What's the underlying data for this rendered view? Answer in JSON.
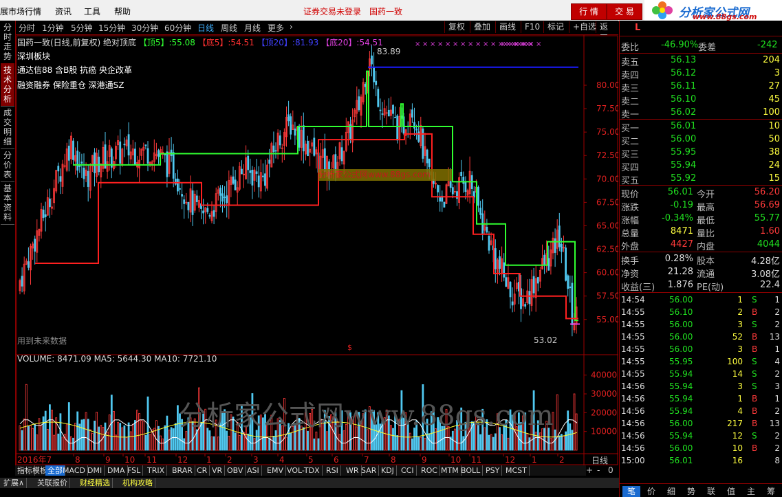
{
  "menu": {
    "title": "展市场行情",
    "items": [
      "资讯",
      "工具",
      "帮助"
    ],
    "notice1": "证券交易未登录",
    "notice2": "国药一致",
    "btn_quote": "行 情",
    "btn_trade": "交 易"
  },
  "logo": {
    "name": "分析家公式网",
    "url": "www.88gs.com"
  },
  "left_tabs": [
    "分时走势",
    "技术分析",
    "成交明细",
    "分价表",
    "基本资料"
  ],
  "periods": [
    "分时",
    "1分钟",
    "5分钟",
    "15分钟",
    "30分钟",
    "60分钟",
    "日线",
    "周线",
    "月线",
    "更多"
  ],
  "active_period": "日线",
  "toolbar": [
    "复权",
    "叠加",
    "画线",
    "F10",
    "标记",
    "+自选",
    "返回"
  ],
  "indicator_line": {
    "name": "国药一致(日线,前复权)",
    "formula": "绝对顶底",
    "top5_label": "【顶5】",
    "top5": "55.08",
    "bot5_label": "【底5】",
    "bot5": "54.51",
    "top20_label": "【顶20】",
    "top20": "81.93",
    "bot20_label": "【底20】",
    "bot20": "54.51"
  },
  "concepts": [
    "深圳板块",
    "通达信88 含B股 抗癌 央企改革",
    "融资融券 保险重仓 深港通SZ"
  ],
  "watermark_main": "分析家公式网www.88gs.com",
  "watermark_vol": "分析家公式网www.88gs.com",
  "future_data": "用到未来数据",
  "high_label": "83.89",
  "low_label": "53.02",
  "price_ticks": [
    "80.00",
    "77.50",
    "75.00",
    "72.50",
    "70.00",
    "67.50",
    "65.00",
    "62.50",
    "60.00",
    "57.50",
    "55.00"
  ],
  "volume_line": {
    "vol": "VOLUME: 8471.09",
    "ma5": "MA5: 5644.30",
    "ma10": "MA10: 7721.10"
  },
  "vol_ticks": [
    "40000",
    "30000",
    "20000",
    "10000"
  ],
  "dates": [
    "2016年7",
    "8",
    "9",
    "10",
    "11",
    "12",
    "1",
    "2",
    "3",
    "4",
    "5",
    "6",
    "7",
    "8",
    "9",
    "10",
    "11",
    "12",
    "1",
    "2"
  ],
  "period_label": "日线",
  "indicator_tabs": [
    "指标",
    "模板",
    "全部",
    "MACD",
    "DMI",
    "DMA",
    "FSL",
    "TRIX",
    "BRAR",
    "CR",
    "VR",
    "OBV",
    "ASI",
    "EMV",
    "VOL-TDX",
    "RSI",
    "WR",
    "SAR",
    "KDJ",
    "CCI",
    "ROC",
    "MTM",
    "BOLL",
    "PSY",
    "MCST"
  ],
  "ext_tabs": [
    "扩展∧",
    "关联报价",
    "财经精选",
    "机构攻略"
  ],
  "stock": {
    "code_mark": "L",
    "webi_label": "委比",
    "webi": "-46.90%",
    "wecha_label": "委差",
    "wecha": "-242",
    "asks": [
      {
        "l": "卖五",
        "p": "56.13",
        "v": "204"
      },
      {
        "l": "卖四",
        "p": "56.12",
        "v": "3"
      },
      {
        "l": "卖三",
        "p": "56.11",
        "v": "27"
      },
      {
        "l": "卖二",
        "p": "56.10",
        "v": "45"
      },
      {
        "l": "卖一",
        "p": "56.02",
        "v": "100"
      }
    ],
    "bids": [
      {
        "l": "买一",
        "p": "56.01",
        "v": "10"
      },
      {
        "l": "买二",
        "p": "56.00",
        "v": "50"
      },
      {
        "l": "买三",
        "p": "55.95",
        "v": "38"
      },
      {
        "l": "买四",
        "p": "55.94",
        "v": "24"
      },
      {
        "l": "买五",
        "p": "55.92",
        "v": "15"
      }
    ],
    "quote": [
      {
        "l1": "现价",
        "v1": "56.01",
        "l2": "今开",
        "v2": "56.20"
      },
      {
        "l1": "涨跌",
        "v1": "-0.19",
        "l2": "最高",
        "v2": "56.69"
      },
      {
        "l1": "涨幅",
        "v1": "-0.34%",
        "l2": "最低",
        "v2": "55.77"
      },
      {
        "l1": "总量",
        "v1": "8471",
        "l2": "量比",
        "v2": "1.60"
      },
      {
        "l1": "外盘",
        "v1": "4427",
        "l2": "内盘",
        "v2": "4044"
      }
    ],
    "fin": [
      {
        "l1": "换手",
        "v1": "0.28%",
        "l2": "股本",
        "v2": "4.28亿"
      },
      {
        "l1": "净资",
        "v1": "21.28",
        "l2": "流通",
        "v2": "3.08亿"
      },
      {
        "l1": "收益(三)",
        "v1": "1.876",
        "l2": "PE(动)",
        "v2": "22.4"
      }
    ],
    "ticks": [
      {
        "t": "14:54",
        "p": "56.00",
        "v": "1",
        "s": "S",
        "n": "1"
      },
      {
        "t": "14:55",
        "p": "56.10",
        "v": "2",
        "s": "B",
        "n": "2"
      },
      {
        "t": "14:55",
        "p": "56.00",
        "v": "3",
        "s": "S",
        "n": "2"
      },
      {
        "t": "14:55",
        "p": "56.00",
        "v": "52",
        "s": "B",
        "n": "13"
      },
      {
        "t": "14:55",
        "p": "56.00",
        "v": "3",
        "s": "B",
        "n": "1"
      },
      {
        "t": "14:55",
        "p": "55.95",
        "v": "100",
        "s": "S",
        "n": "4"
      },
      {
        "t": "14:55",
        "p": "55.94",
        "v": "14",
        "s": "S",
        "n": "2"
      },
      {
        "t": "14:56",
        "p": "55.94",
        "v": "3",
        "s": "S",
        "n": "3"
      },
      {
        "t": "14:56",
        "p": "55.94",
        "v": "1",
        "s": "B",
        "n": "1"
      },
      {
        "t": "14:56",
        "p": "55.94",
        "v": "4",
        "s": "B",
        "n": "2"
      },
      {
        "t": "14:56",
        "p": "56.00",
        "v": "217",
        "s": "B",
        "n": "13"
      },
      {
        "t": "14:56",
        "p": "55.94",
        "v": "12",
        "s": "S",
        "n": "2"
      },
      {
        "t": "14:56",
        "p": "56.00",
        "v": "10",
        "s": "B",
        "n": "2"
      },
      {
        "t": "15:00",
        "p": "56.01",
        "v": "16",
        "s": "",
        "n": "8"
      }
    ],
    "bottom_tabs": [
      "笔",
      "价",
      "细",
      "势",
      "联",
      "值",
      "主",
      "筹"
    ]
  },
  "colors": {
    "up": "#ff3a3a",
    "down": "#20e020",
    "top_line": "#30ff30",
    "bottom_line": "#ff2020",
    "top20_line": "#1a1aff"
  }
}
